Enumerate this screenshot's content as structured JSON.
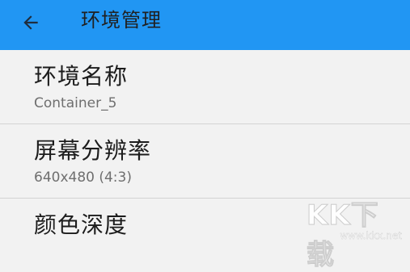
{
  "app_bar": {
    "title": "环境管理",
    "back_icon": "arrow-left-icon",
    "background": "#2196f3"
  },
  "settings": [
    {
      "title": "环境名称",
      "subtitle": "Container_5"
    },
    {
      "title": "屏幕分辨率",
      "subtitle": "640x480 (4:3)"
    },
    {
      "title": "颜色深度",
      "subtitle": ""
    }
  ],
  "watermark": {
    "logo_text": "KK下载",
    "url": "www.kkx.net"
  }
}
